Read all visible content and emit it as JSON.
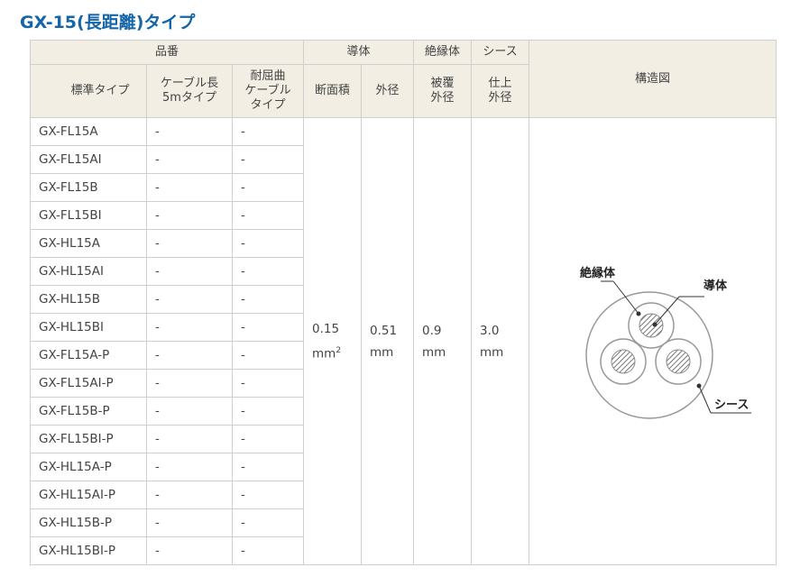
{
  "title": "GX-15(長距離)タイプ",
  "header": {
    "group_part": "品番",
    "group_conductor": "導体",
    "group_insulator": "絶縁体",
    "group_sheath": "シース",
    "structure": "構造図",
    "col_standard": "標準タイプ",
    "col_cable5m": "ケーブル長\n5mタイプ",
    "col_flex": "耐屈曲\nケーブル\nタイプ",
    "col_area": "断面積",
    "col_conductor_od": "外径",
    "col_insulator_od": "被覆\n外径",
    "col_sheath_od": "仕上\n外径"
  },
  "rows": [
    {
      "model": "GX-FL15A",
      "cable5m": "-",
      "flex": "-"
    },
    {
      "model": "GX-FL15AI",
      "cable5m": "-",
      "flex": "-"
    },
    {
      "model": "GX-FL15B",
      "cable5m": "-",
      "flex": "-"
    },
    {
      "model": "GX-FL15BI",
      "cable5m": "-",
      "flex": "-"
    },
    {
      "model": "GX-HL15A",
      "cable5m": "-",
      "flex": "-"
    },
    {
      "model": "GX-HL15AI",
      "cable5m": "-",
      "flex": "-"
    },
    {
      "model": "GX-HL15B",
      "cable5m": "-",
      "flex": "-"
    },
    {
      "model": "GX-HL15BI",
      "cable5m": "-",
      "flex": "-"
    },
    {
      "model": "GX-FL15A-P",
      "cable5m": "-",
      "flex": "-"
    },
    {
      "model": "GX-FL15AI-P",
      "cable5m": "-",
      "flex": "-"
    },
    {
      "model": "GX-FL15B-P",
      "cable5m": "-",
      "flex": "-"
    },
    {
      "model": "GX-FL15BI-P",
      "cable5m": "-",
      "flex": "-"
    },
    {
      "model": "GX-HL15A-P",
      "cable5m": "-",
      "flex": "-"
    },
    {
      "model": "GX-HL15AI-P",
      "cable5m": "-",
      "flex": "-"
    },
    {
      "model": "GX-HL15B-P",
      "cable5m": "-",
      "flex": "-"
    },
    {
      "model": "GX-HL15BI-P",
      "cable5m": "-",
      "flex": "-"
    }
  ],
  "specs": {
    "area_value": "0.15",
    "area_unit": "mm",
    "area_exp": "2",
    "conductor_od_value": "0.51",
    "insulator_od_value": "0.9",
    "sheath_od_value": "3.0",
    "unit": "mm"
  },
  "diagram": {
    "label_insulator": "絶縁体",
    "label_conductor": "導体",
    "label_sheath": "シース"
  }
}
